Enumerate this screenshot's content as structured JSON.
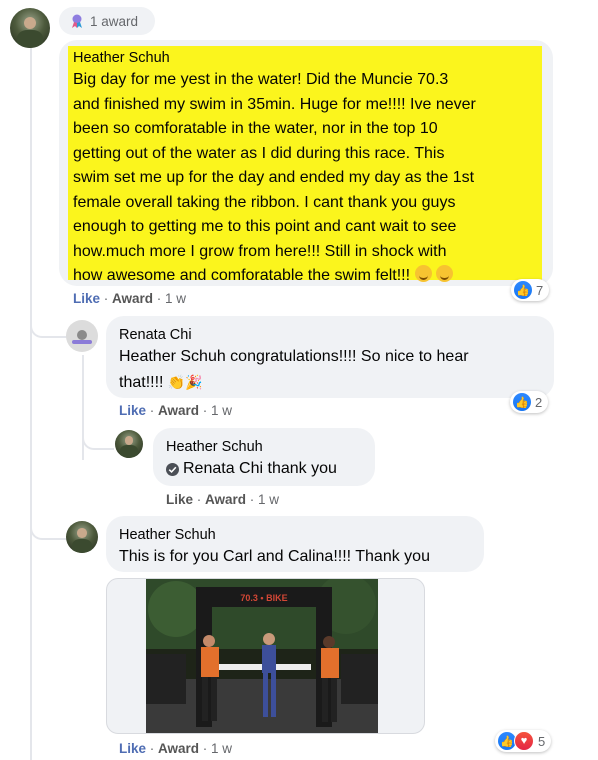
{
  "award_pill": {
    "label": "1 award"
  },
  "comment1": {
    "author": "Heather Schuh",
    "lines": [
      "Big day for me yest in the water! Did the Muncie 70.3",
      "and finished my swim in 35min. Huge for me!!!! Ive never",
      "been so comforatable in the water, nor in the top 10",
      "getting out of the water as I did during this race. This",
      "swim set me up for the day and ended my day as the 1st",
      "female overall taking the ribbon. I cant thank you guys",
      "enough to getting me to this point and cant wait to see",
      "how.much more I grow from here!!! Still in shock with",
      "how awesome and comforatable the swim felt!!!"
    ],
    "like": "Like",
    "award": "Award",
    "time": "1 w",
    "reactions": "7",
    "highlight_color": "#fbf51d"
  },
  "reply1": {
    "author": "Renata Chi",
    "mention": "Heather Schuh",
    "text_line1": " congratulations!!!! So nice to hear",
    "text_line2": "that!!!!",
    "like": "Like",
    "award": "Award",
    "time": "1 w",
    "reactions": "2"
  },
  "reply2": {
    "author": "Heather Schuh",
    "mention": "Renata Chi",
    "text": " thank you",
    "like": "Like",
    "award": "Award",
    "time": "1 w"
  },
  "reply3": {
    "author": "Heather Schuh",
    "text": "This is for you Carl and Calina!!!! Thank you",
    "arch_text": "70.3 • BIKE",
    "like": "Like",
    "award": "Award",
    "time": "1 w",
    "reactions": "5"
  },
  "icons": {
    "award": "award-ribbon-icon",
    "like": "thumbs-up-icon",
    "love": "heart-icon",
    "check": "check-circle-icon",
    "smile": "smiling-emoji-icon",
    "clap": "clapping-emoji-icon",
    "party": "party-popper-emoji-icon"
  },
  "colors": {
    "link": "#4f6db3",
    "meta": "#65676b",
    "bubble": "#f0f2f5",
    "like_blue": "#1877f2"
  }
}
